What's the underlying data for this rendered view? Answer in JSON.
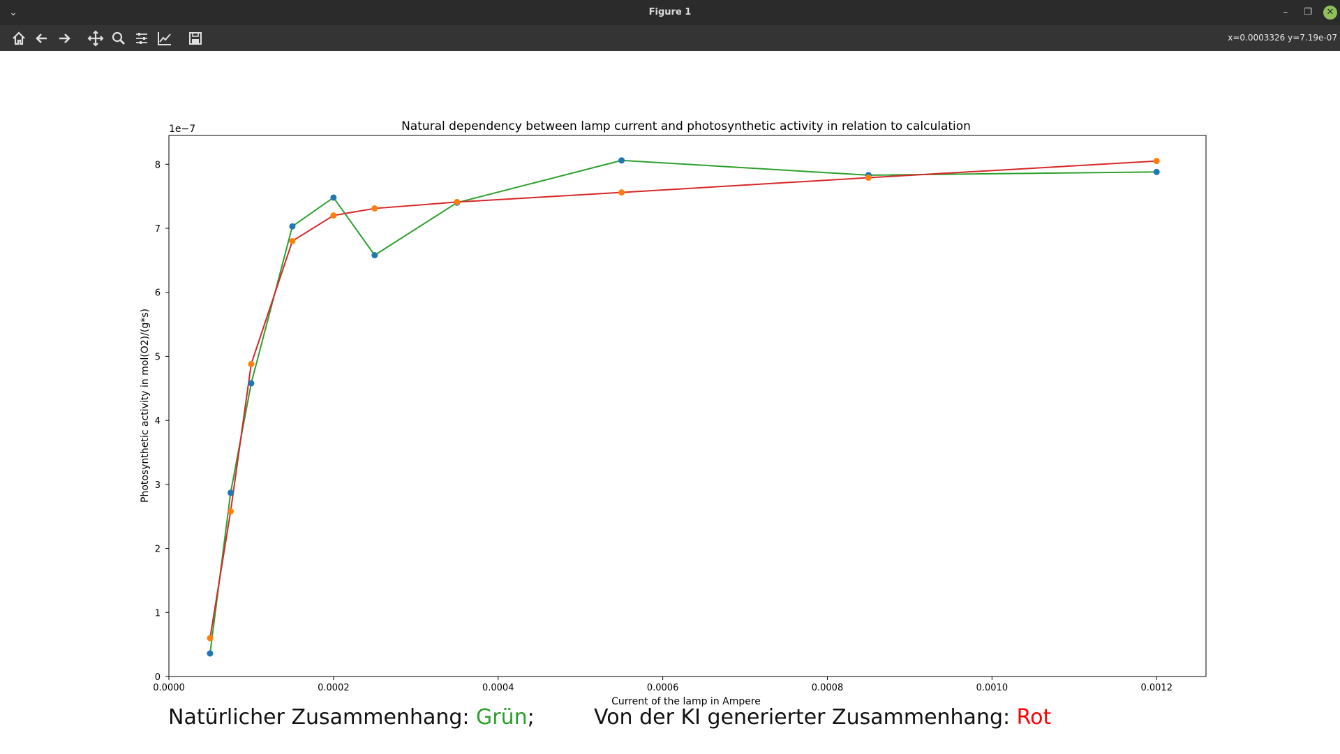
{
  "window": {
    "title": "Figure 1"
  },
  "toolbar": {
    "tools": [
      "home-icon",
      "back-icon",
      "forward-icon",
      "pan-icon",
      "zoom-icon",
      "configure-subplots-icon",
      "edit-axis-icon",
      "save-icon"
    ],
    "coords": "x=0.0003326 y=7.19e-07"
  },
  "chart_data": {
    "type": "line",
    "title": "Natural dependency between lamp current and photosynthetic activity in relation to calculation",
    "xlabel": "Current of the lamp in Ampere",
    "ylabel": "Photosynthetic activity in mol(O2)/(g*s)",
    "y_multiplier_label": "1e−7",
    "xlim": [
      0,
      0.00126
    ],
    "ylim": [
      0,
      8.45e-07
    ],
    "x_ticks": [
      0,
      0.0002,
      0.0004,
      0.0006,
      0.0008,
      0.001,
      0.0012
    ],
    "x_tick_labels": [
      "0.0000",
      "0.0002",
      "0.0004",
      "0.0006",
      "0.0008",
      "0.0010",
      "0.0012"
    ],
    "y_ticks": [
      0,
      1,
      2,
      3,
      4,
      5,
      6,
      7,
      8
    ],
    "y_tick_labels": [
      "0",
      "1",
      "2",
      "3",
      "4",
      "5",
      "6",
      "7",
      "8"
    ],
    "x": [
      5e-05,
      7.5e-05,
      0.0001,
      0.00015,
      0.0002,
      0.00025,
      0.00035,
      0.00055,
      0.00085,
      0.0012
    ],
    "series": [
      {
        "line_color": "#2ca02c",
        "marker_color": "#1f77b4",
        "values": [
          3.6e-08,
          2.87e-07,
          4.58e-07,
          7.03e-07,
          7.48e-07,
          6.58e-07,
          7.4e-07,
          8.06e-07,
          7.83e-07,
          7.88e-07
        ]
      },
      {
        "line_color": "#d62728",
        "marker_color": "#ff7f0e",
        "values": [
          6e-08,
          2.58e-07,
          4.88e-07,
          6.8e-07,
          7.2e-07,
          7.31e-07,
          7.41e-07,
          7.56e-07,
          7.79e-07,
          8.05e-07
        ]
      }
    ],
    "grid": false
  },
  "legend": {
    "natural_label": "Natürlicher Zusammenhang: ",
    "natural_value": "Grün",
    "separator": ";",
    "ki_label": "Von der KI generierter Zusammenhang: ",
    "ki_value": "Rot",
    "natural_color": "#2ca02c",
    "ki_color": "#ff0000"
  }
}
